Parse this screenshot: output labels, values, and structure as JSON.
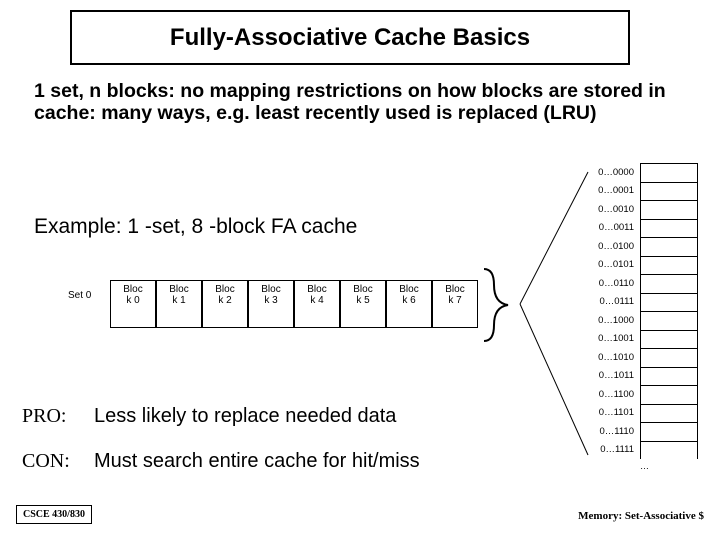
{
  "title": "Fully-Associative Cache Basics",
  "description": "1 set, n blocks: no mapping restrictions on how blocks are stored in cache: many ways, e.g. least recently used is replaced (LRU)",
  "example_label": "Example: 1 -set, 8 -block FA cache",
  "set_label": "Set 0",
  "blocks": [
    {
      "l1": "Bloc",
      "l2": "k 0"
    },
    {
      "l1": "Bloc",
      "l2": "k 1"
    },
    {
      "l1": "Bloc",
      "l2": "k 2"
    },
    {
      "l1": "Bloc",
      "l2": "k 3"
    },
    {
      "l1": "Bloc",
      "l2": "k 4"
    },
    {
      "l1": "Bloc",
      "l2": "k 5"
    },
    {
      "l1": "Bloc",
      "l2": "k 6"
    },
    {
      "l1": "Bloc",
      "l2": "k 7"
    }
  ],
  "memory": [
    "0…0000",
    "0…0001",
    "0…0010",
    "0…0011",
    "0…0100",
    "0…0101",
    "0…0110",
    "0…0111",
    "0…1000",
    "0…1001",
    "0…1010",
    "0…1011",
    "0…1100",
    "0…1101",
    "0…1110",
    "0…1111"
  ],
  "memory_ellipsis": "…",
  "pro_label": "PRO:",
  "pro_text": "Less likely to replace needed data",
  "con_label": "CON:",
  "con_text": "Must search entire cache for hit/miss",
  "footer_left": "CSCE 430/830",
  "footer_right": "Memory: Set-Associative $"
}
